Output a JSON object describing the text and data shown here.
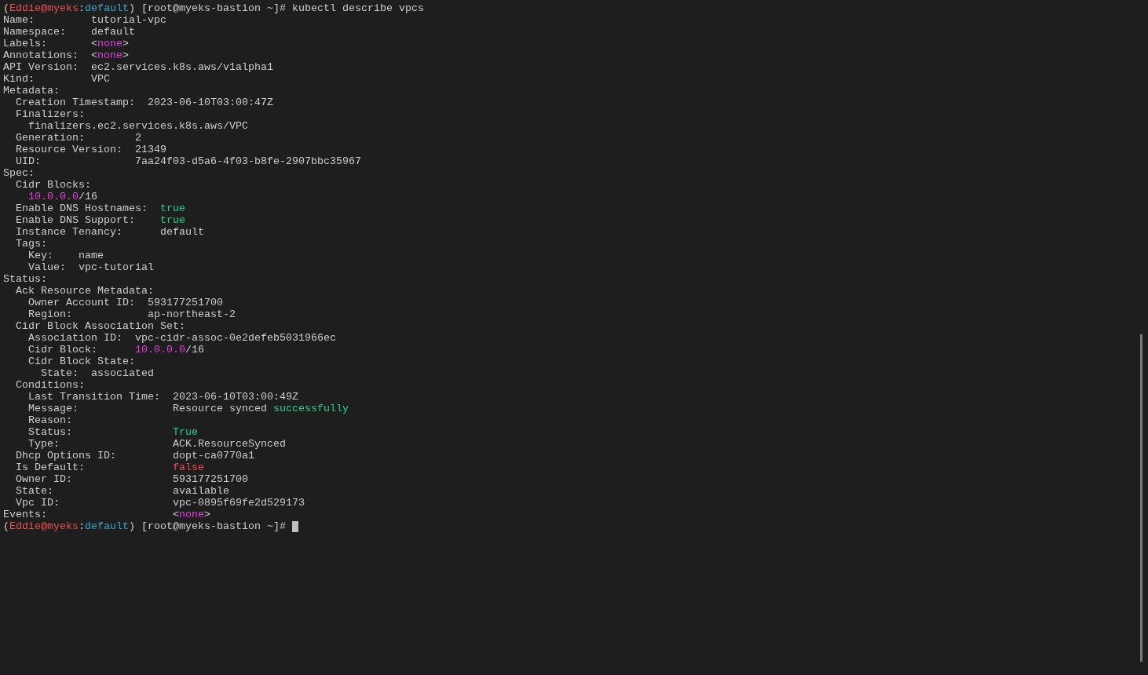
{
  "terminal": {
    "cursor": true,
    "lines": [
      {
        "segments": [
          {
            "text": "("
          },
          {
            "text": "Eddie@myeks",
            "color": "#e8514f"
          },
          {
            "text": ":"
          },
          {
            "text": "default",
            "color": "#3aa6cf"
          },
          {
            "text": ") [root@myeks-bastion ~]# kubectl describe vpcs"
          }
        ]
      },
      {
        "segments": [
          {
            "text": "Name:         tutorial-vpc"
          }
        ]
      },
      {
        "segments": [
          {
            "text": "Namespace:    default"
          }
        ]
      },
      {
        "segments": [
          {
            "text": "Labels:       <"
          },
          {
            "text": "none",
            "color": "#e23ee0"
          },
          {
            "text": ">"
          }
        ]
      },
      {
        "segments": [
          {
            "text": "Annotations:  <"
          },
          {
            "text": "none",
            "color": "#e23ee0"
          },
          {
            "text": ">"
          }
        ]
      },
      {
        "segments": [
          {
            "text": "API Version:  ec2.services.k8s.aws/v1alpha1"
          }
        ]
      },
      {
        "segments": [
          {
            "text": "Kind:         VPC"
          }
        ]
      },
      {
        "segments": [
          {
            "text": "Metadata:"
          }
        ]
      },
      {
        "segments": [
          {
            "text": "  Creation Timestamp:  2023-06-10T03:00:47Z"
          }
        ]
      },
      {
        "segments": [
          {
            "text": "  Finalizers:"
          }
        ]
      },
      {
        "segments": [
          {
            "text": "    finalizers.ec2.services.k8s.aws/VPC"
          }
        ]
      },
      {
        "segments": [
          {
            "text": "  Generation:        2"
          }
        ]
      },
      {
        "segments": [
          {
            "text": "  Resource Version:  21349"
          }
        ]
      },
      {
        "segments": [
          {
            "text": "  UID:               7aa24f03-d5a6-4f03-b8fe-2907bbc35967"
          }
        ]
      },
      {
        "segments": [
          {
            "text": "Spec:"
          }
        ]
      },
      {
        "segments": [
          {
            "text": "  Cidr Blocks:"
          }
        ]
      },
      {
        "segments": [
          {
            "text": "    10.0.0.0",
            "color": "#e23ee0"
          },
          {
            "text": "/16"
          }
        ]
      },
      {
        "segments": [
          {
            "text": "  Enable DNS Hostnames:  "
          },
          {
            "text": "true",
            "color": "#23d18b"
          }
        ]
      },
      {
        "segments": [
          {
            "text": "  Enable DNS Support:    "
          },
          {
            "text": "true",
            "color": "#23d18b"
          }
        ]
      },
      {
        "segments": [
          {
            "text": "  Instance Tenancy:      default"
          }
        ]
      },
      {
        "segments": [
          {
            "text": "  Tags:"
          }
        ]
      },
      {
        "segments": [
          {
            "text": "    Key:    name"
          }
        ]
      },
      {
        "segments": [
          {
            "text": "    Value:  vpc-tutorial"
          }
        ]
      },
      {
        "segments": [
          {
            "text": "Status:"
          }
        ]
      },
      {
        "segments": [
          {
            "text": "  Ack Resource Metadata:"
          }
        ]
      },
      {
        "segments": [
          {
            "text": "    Owner Account ID:  593177251700"
          }
        ]
      },
      {
        "segments": [
          {
            "text": "    Region:            ap-northeast-2"
          }
        ]
      },
      {
        "segments": [
          {
            "text": "  Cidr Block Association Set:"
          }
        ]
      },
      {
        "segments": [
          {
            "text": "    Association ID:  vpc-cidr-assoc-0e2defeb5031966ec"
          }
        ]
      },
      {
        "segments": [
          {
            "text": "    Cidr Block:      "
          },
          {
            "text": "10.0.0.0",
            "color": "#e23ee0"
          },
          {
            "text": "/16"
          }
        ]
      },
      {
        "segments": [
          {
            "text": "    Cidr Block State:"
          }
        ]
      },
      {
        "segments": [
          {
            "text": "      State:  associated"
          }
        ]
      },
      {
        "segments": [
          {
            "text": "  Conditions:"
          }
        ]
      },
      {
        "segments": [
          {
            "text": "    Last Transition Time:  2023-06-10T03:00:49Z"
          }
        ]
      },
      {
        "segments": [
          {
            "text": "    Message:               Resource synced "
          },
          {
            "text": "successfully",
            "color": "#23d18b"
          }
        ]
      },
      {
        "segments": [
          {
            "text": "    Reason:"
          }
        ]
      },
      {
        "segments": [
          {
            "text": "    Status:                "
          },
          {
            "text": "True",
            "color": "#23d18b"
          }
        ]
      },
      {
        "segments": [
          {
            "text": "    Type:                  ACK.ResourceSynced"
          }
        ]
      },
      {
        "segments": [
          {
            "text": "  Dhcp Options ID:         dopt-ca0770a1"
          }
        ]
      },
      {
        "segments": [
          {
            "text": "  Is Default:              "
          },
          {
            "text": "false",
            "color": "#f14c4c"
          }
        ]
      },
      {
        "segments": [
          {
            "text": "  Owner ID:                593177251700"
          }
        ]
      },
      {
        "segments": [
          {
            "text": "  State:                   available"
          }
        ]
      },
      {
        "segments": [
          {
            "text": "  Vpc ID:                  vpc-0895f69fe2d529173"
          }
        ]
      },
      {
        "segments": [
          {
            "text": "Events:                    <"
          },
          {
            "text": "none",
            "color": "#e23ee0"
          },
          {
            "text": ">"
          }
        ]
      },
      {
        "segments": [
          {
            "text": "("
          },
          {
            "text": "Eddie@myeks",
            "color": "#e8514f"
          },
          {
            "text": ":"
          },
          {
            "text": "default",
            "color": "#3aa6cf"
          },
          {
            "text": ") [root@myeks-bastion ~]# "
          }
        ]
      }
    ]
  }
}
